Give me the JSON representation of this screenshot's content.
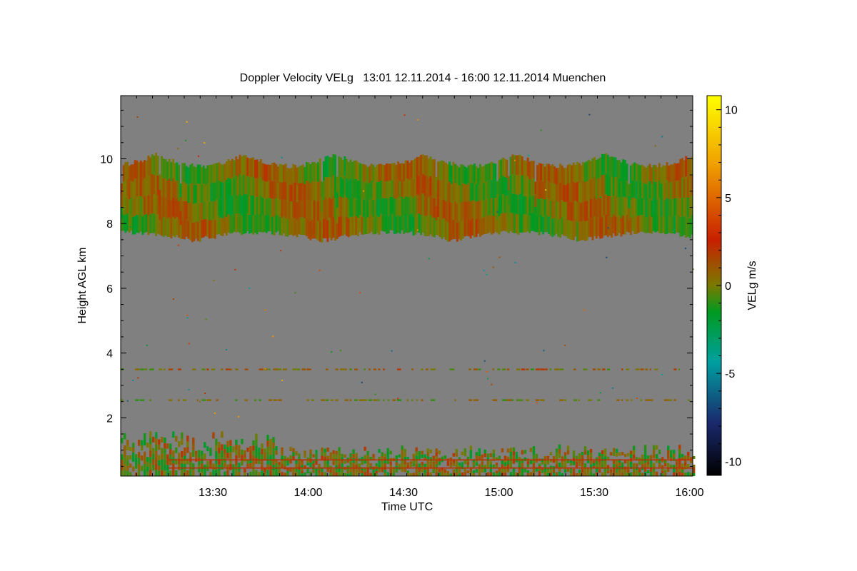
{
  "chart_data": {
    "type": "heatmap",
    "title": "Doppler Velocity VELg   13:01 12.11.2014 - 16:00 12.11.2014 Muenchen",
    "xlabel": "Time UTC",
    "ylabel": "Height AGL km",
    "colorbar_label": "VELg m/s",
    "xlim": [
      "13:01",
      "16:01"
    ],
    "ylim": [
      0.2,
      11.95
    ],
    "x_ticks": [
      "13:30",
      "14:00",
      "14:30",
      "15:00",
      "15:30",
      "16:00"
    ],
    "y_ticks": [
      "2",
      "4",
      "6",
      "8",
      "10"
    ],
    "colorbar_ticks": [
      "10",
      "5",
      "0",
      "-5",
      "-10"
    ],
    "colorbar_range": [
      -10.8,
      10.8
    ],
    "background_color": "#808080",
    "colormap": [
      "#000000",
      "#1a2a6e",
      "#00a0a0",
      "#009a20",
      "#7a7a00",
      "#c82000",
      "#f0a000",
      "#ffff00"
    ],
    "features": [
      {
        "name": "cloud layer",
        "height_km": [
          7.4,
          10.2
        ],
        "velocity_ms": [
          -2,
          2
        ]
      },
      {
        "name": "boundary layer",
        "height_km": [
          0.2,
          1.6
        ],
        "velocity_ms": [
          -2,
          2
        ]
      },
      {
        "name": "aerosol layer",
        "height_km": [
          3.5,
          3.5
        ],
        "velocity_ms": [
          -1,
          2
        ]
      },
      {
        "name": "aerosol layer",
        "height_km": [
          2.55,
          2.55
        ],
        "velocity_ms": [
          -1,
          1
        ]
      }
    ]
  }
}
